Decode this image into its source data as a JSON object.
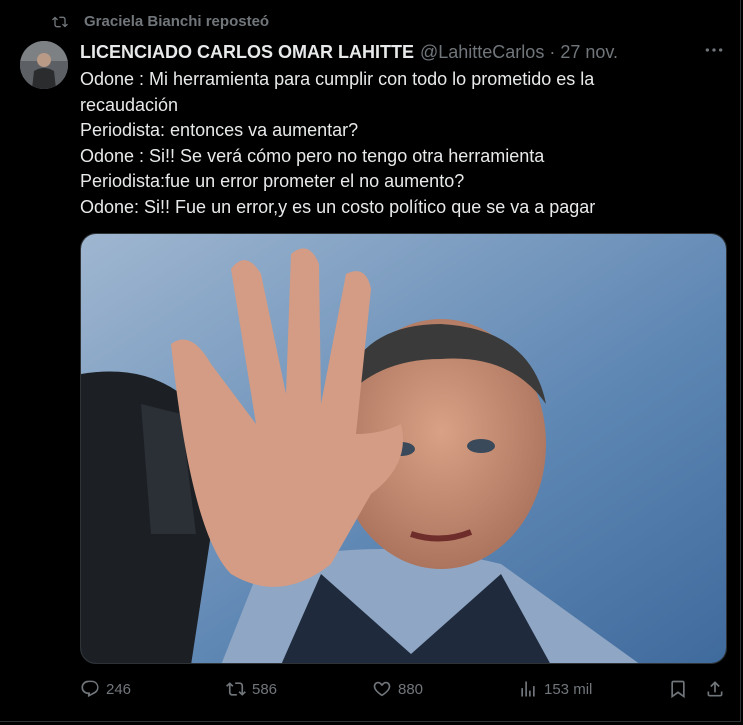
{
  "repost": {
    "text": "Graciela Bianchi reposteó"
  },
  "tweet": {
    "author_name": "LICENCIADO CARLOS OMAR LAHITTE",
    "handle": "@LahitteCarlos",
    "separator": "·",
    "date": "27 nov.",
    "lines": [
      "Odone : Mi herramienta para cumplir con todo lo prometido es la recaudación",
      "Periodista: entonces va aumentar?",
      "Odone : Si!! Se verá cómo pero no tengo otra herramienta",
      "Periodista:fue un error prometer el no aumento?",
      "Odone: Si!! Fue un error,y es un costo político que se va a pagar"
    ]
  },
  "actions": {
    "replies": "246",
    "reposts": "586",
    "likes": "880",
    "views": "153 mil"
  },
  "icons": {
    "repost_header": "repost-icon",
    "more": "more-icon",
    "reply": "reply-icon",
    "retweet": "retweet-icon",
    "like": "heart-icon",
    "views": "views-icon",
    "bookmark": "bookmark-icon",
    "share": "share-icon"
  },
  "colors": {
    "background": "#000000",
    "text": "#e7e9ea",
    "muted": "#71767b",
    "border": "#2f3336"
  }
}
